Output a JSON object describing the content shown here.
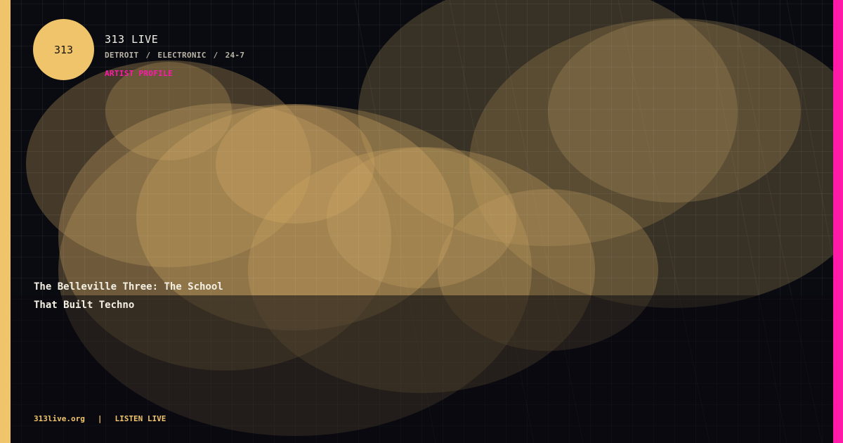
{
  "brand": {
    "logo_text": "313",
    "name": "313 LIVE",
    "tags": [
      "DETROIT",
      "ELECTRONIC",
      "24-7"
    ],
    "tag_separator": "/",
    "section_label": "ARTIST PROFILE"
  },
  "headline": {
    "line1": "The Belleville Three: The School",
    "line2": "That Built Techno"
  },
  "footer": {
    "site": "313live.org",
    "divider": "|",
    "cta": "LISTEN LIVE"
  },
  "colors": {
    "background": "#0a0b10",
    "accent_gold": "#f0c46a",
    "accent_magenta": "#ff1aa8",
    "text_light": "#f2efe6",
    "text_muted": "#b9b4a6"
  }
}
